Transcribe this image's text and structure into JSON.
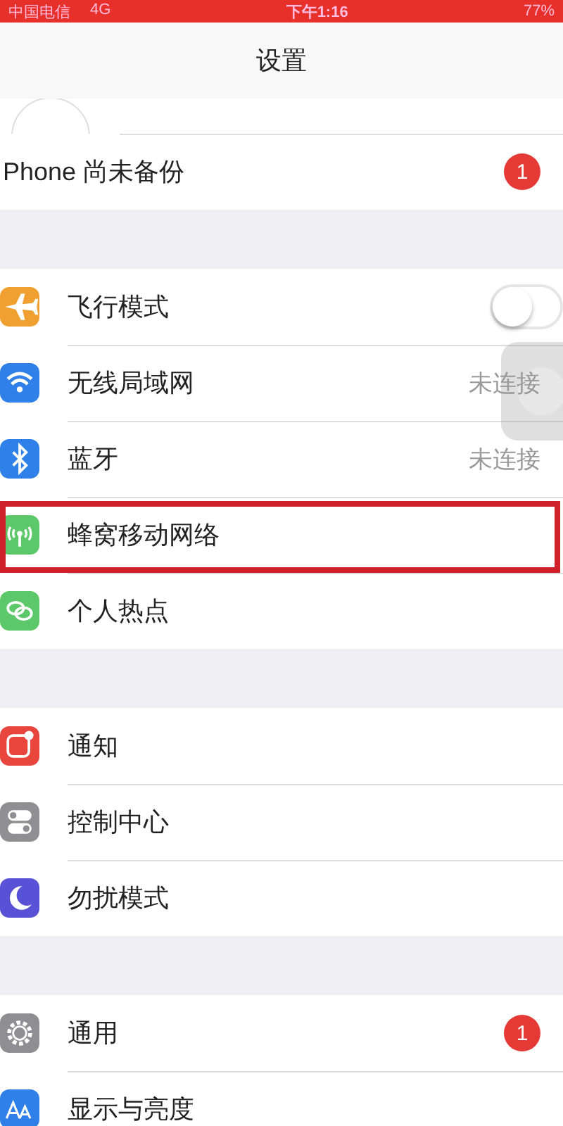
{
  "status_bar": {
    "carrier": "中国电信",
    "network": "4G",
    "time": "下午1:16",
    "battery": "77%"
  },
  "nav": {
    "title": "设置"
  },
  "groups": [
    {
      "rows": [
        {
          "kind": "profile",
          "highlighted": false
        },
        {
          "kind": "notice",
          "label": "Phone 尚未备份",
          "badge": "1",
          "highlighted": false
        }
      ]
    },
    {
      "rows": [
        {
          "kind": "toggle",
          "label": "飞行模式",
          "on": false,
          "color": "#f0a030",
          "highlighted": false
        },
        {
          "kind": "detail",
          "label": "无线局域网",
          "value": "未连接",
          "color": "#2f80e8",
          "highlighted": false
        },
        {
          "kind": "detail",
          "label": "蓝牙",
          "value": "未连接",
          "color": "#2f80e8",
          "highlighted": false
        },
        {
          "kind": "link",
          "label": "蜂窝移动网络",
          "color": "#5cc86a",
          "highlighted": true
        },
        {
          "kind": "link",
          "label": "个人热点",
          "color": "#5cc86a",
          "highlighted": false
        }
      ]
    },
    {
      "rows": [
        {
          "kind": "link",
          "label": "通知",
          "color": "#e8453c",
          "highlighted": false
        },
        {
          "kind": "link",
          "label": "控制中心",
          "color": "#8e8e93",
          "highlighted": false
        },
        {
          "kind": "link",
          "label": "勿扰模式",
          "color": "#5a52d6",
          "highlighted": false
        }
      ]
    },
    {
      "rows": [
        {
          "kind": "link",
          "label": "通用",
          "badge": "1",
          "color": "#8e8e93",
          "highlighted": false
        },
        {
          "kind": "link",
          "label": "显示与亮度",
          "color": "#2f80e8",
          "highlighted": false
        }
      ]
    }
  ]
}
